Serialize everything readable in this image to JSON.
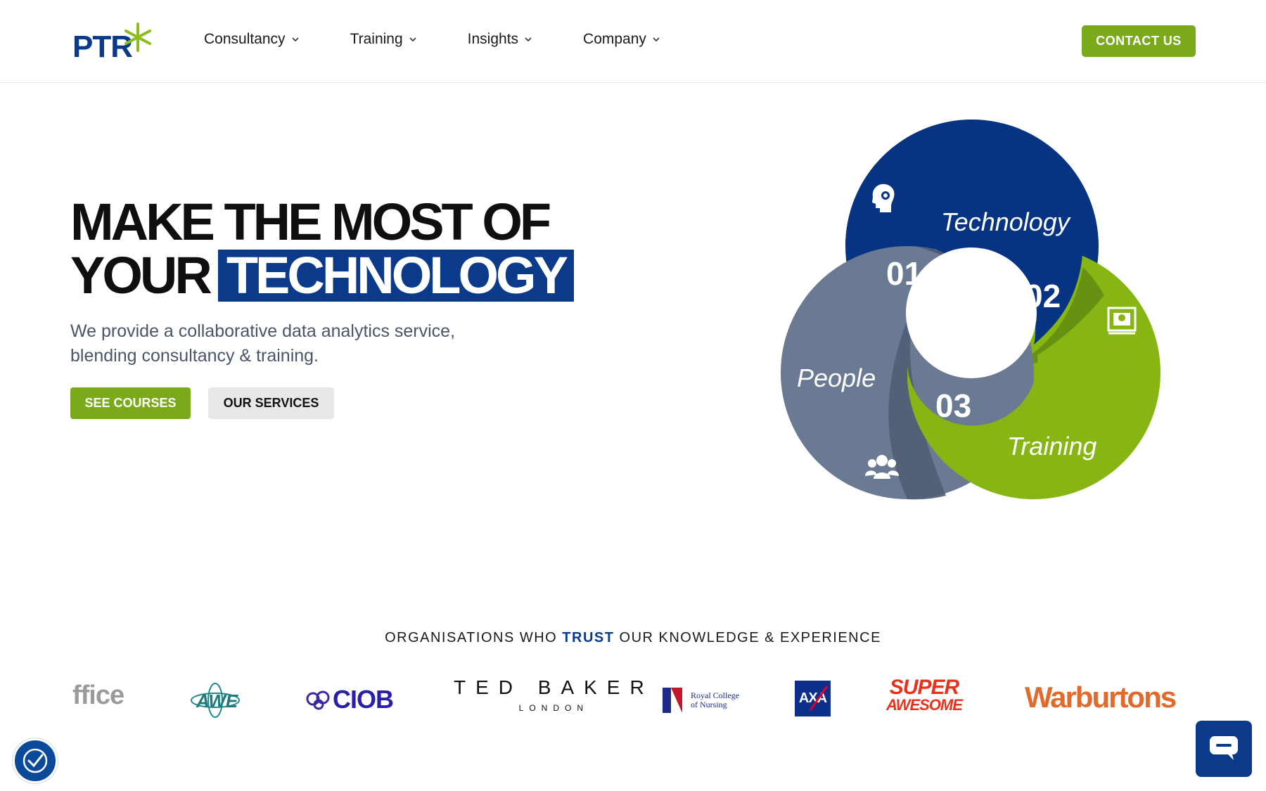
{
  "header": {
    "logo_text": "PTR",
    "nav": [
      {
        "label": "Consultancy"
      },
      {
        "label": "Training"
      },
      {
        "label": "Insights"
      },
      {
        "label": "Company"
      }
    ],
    "contact_label": "CONTACT US"
  },
  "hero": {
    "title_line1": "MAKE THE MOST OF",
    "title_line2_prefix": "YOUR",
    "title_highlight": "TECHNOLOGY",
    "subtitle": "We provide a collaborative data analytics service, blending consultancy & training.",
    "btn_courses": "SEE COURSES",
    "btn_services": "OUR SERVICES"
  },
  "diagram": {
    "segments": [
      {
        "number": "01",
        "label": "People",
        "color": "#6b7a93"
      },
      {
        "number": "02",
        "label": "Technology",
        "color": "#063382"
      },
      {
        "number": "03",
        "label": "Training",
        "color": "#86b514"
      }
    ]
  },
  "orgs": {
    "title_before": "ORGANISATIONS WHO ",
    "title_trust": "TRUST",
    "title_after": " OUR KNOWLEDGE & EXPERIENCE",
    "logos": [
      {
        "name": "office",
        "text": "ffice"
      },
      {
        "name": "awe",
        "text": "AWE"
      },
      {
        "name": "ciob",
        "text": "CIOB"
      },
      {
        "name": "ted-baker",
        "text": "TED BAKER",
        "sub": "LONDON"
      },
      {
        "name": "rcn",
        "text": "Royal College",
        "sub": "of Nursing"
      },
      {
        "name": "axa",
        "text": "AXA"
      },
      {
        "name": "super-awesome",
        "text": "SUPER",
        "sub": "AWESOME"
      },
      {
        "name": "warburtons",
        "text": "Warburtons"
      }
    ]
  },
  "colors": {
    "brand_blue": "#0b3a8a",
    "brand_green": "#7aaa1b",
    "slate": "#6b7a93"
  }
}
